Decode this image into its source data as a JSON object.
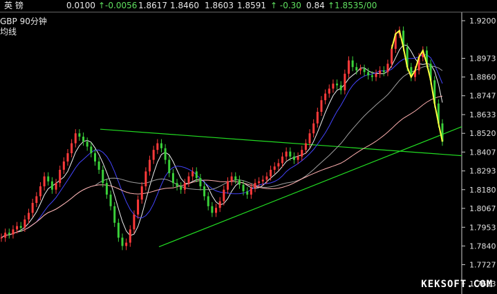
{
  "header": {
    "name": "英  镑",
    "change_step": "0.0100",
    "change": "↑-0.0056",
    "open": "1.8617",
    "low": "1.8460",
    "high": "1.8603",
    "last": "1.8591",
    "pct": "↑ -0.30",
    "ratio": "0.84",
    "bid_ask": "↑1.8535/00"
  },
  "panel": {
    "title": "GBP  90分钟",
    "subtitle": "均线"
  },
  "watermark": "KEKSOFT.COM",
  "colors": {
    "background": "#000000",
    "grid": "#d0d0d0",
    "candle_up": "#ff3a3a",
    "candle_down": "#3ad13a",
    "ma_fast": "#f0f0f0",
    "ma_mid": "#4444ff",
    "ma_slow": "#a0a0a0",
    "ma_long": "#ffb0b0",
    "trendline": "#22dd22",
    "highlight": "#ffff40"
  },
  "chart_data": {
    "type": "line",
    "title": "",
    "xlabel": "",
    "ylabel": "",
    "ylim": [
      1.755,
      1.925
    ],
    "y_ticks": [
      "1.9200",
      "1.8973",
      "1.8860",
      "1.8747",
      "1.8633",
      "1.8520",
      "1.8407",
      "1.8293",
      "1.8180",
      "1.8067",
      "1.7953",
      "1.7840",
      "1.7727",
      "1.7613"
    ],
    "grid": true,
    "series": [
      {
        "values": [
          1.789,
          1.792,
          1.791,
          1.794,
          1.796,
          1.795,
          1.8,
          1.804,
          1.81,
          1.814,
          1.82,
          1.826,
          1.823,
          1.818,
          1.822,
          1.83,
          1.835,
          1.84,
          1.846,
          1.852,
          1.85,
          1.847,
          1.844,
          1.84,
          1.835,
          1.83,
          1.822,
          1.815,
          1.808,
          1.798,
          1.789,
          1.784,
          1.786,
          1.794,
          1.803,
          1.812,
          1.82,
          1.829,
          1.836,
          1.842,
          1.846,
          1.843,
          1.836,
          1.828,
          1.822,
          1.82,
          1.818,
          1.822,
          1.826,
          1.829,
          1.825,
          1.82,
          1.814,
          1.808,
          1.804,
          1.807,
          1.811,
          1.818,
          1.823,
          1.826,
          1.824,
          1.821,
          1.817,
          1.815,
          1.819,
          1.822,
          1.823,
          1.824,
          1.826,
          1.83,
          1.832,
          1.834,
          1.838,
          1.841,
          1.838,
          1.836,
          1.838,
          1.842,
          1.846,
          1.852,
          1.858,
          1.865,
          1.872,
          1.876,
          1.879,
          1.882,
          1.881,
          1.878,
          1.888,
          1.896,
          1.892,
          1.89,
          1.891,
          1.889,
          1.887,
          1.886,
          1.888,
          1.89,
          1.889,
          1.894,
          1.903,
          1.912,
          1.914,
          1.904,
          1.892,
          1.886,
          1.89,
          1.898,
          1.902,
          1.894,
          1.884,
          1.87,
          1.858,
          1.847
        ]
      }
    ]
  }
}
